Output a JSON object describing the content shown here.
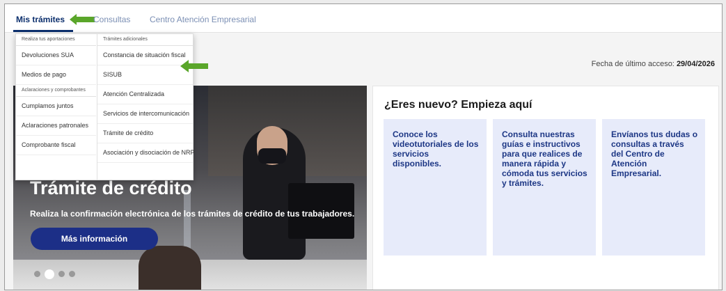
{
  "nav": {
    "tabs": [
      {
        "label": "Mis trámites"
      },
      {
        "label": "Consultas"
      },
      {
        "label": "Centro Atención Empresarial"
      }
    ]
  },
  "dropdown": {
    "col1": {
      "header": "Realiza tus aportaciones",
      "items": [
        "Devoluciones SUA",
        "Medios de pago"
      ],
      "header2": "Aclaraciones y comprobantes",
      "items2": [
        "Cumplamos juntos",
        "Aclaraciones patronales",
        "Comprobante fiscal"
      ]
    },
    "col2": {
      "header": "Trámites adicionales",
      "items": [
        "Constancia de situación fiscal",
        "SISUB",
        "Atención Centralizada",
        "Servicios de intercomunicación",
        "Trámite de crédito",
        "Asociación y disociación de NRP"
      ]
    }
  },
  "access": {
    "label": "Fecha de último acceso:",
    "date": "29/04/2026"
  },
  "hero": {
    "title": "Trámite de crédito",
    "subtitle": "Realiza la confirmación electrónica de los trámites de crédito de tus trabajadores.",
    "button": "Más información"
  },
  "new_section": {
    "title": "¿Eres nuevo? Empieza aquí",
    "tiles": [
      "Conoce los videotutoriales de los servicios disponibles.",
      "Consulta nuestras guías e instructivos para que realices de manera rápida y cómoda tus servicios y trámites.",
      "Envíanos tus dudas o consultas a través del Centro de Atención Empresarial."
    ]
  },
  "colors": {
    "primary": "#1c2f87",
    "tile_bg": "#e7ebfa",
    "arrow": "#5aa62a"
  },
  "icons": [
    "green-arrow-icon"
  ]
}
